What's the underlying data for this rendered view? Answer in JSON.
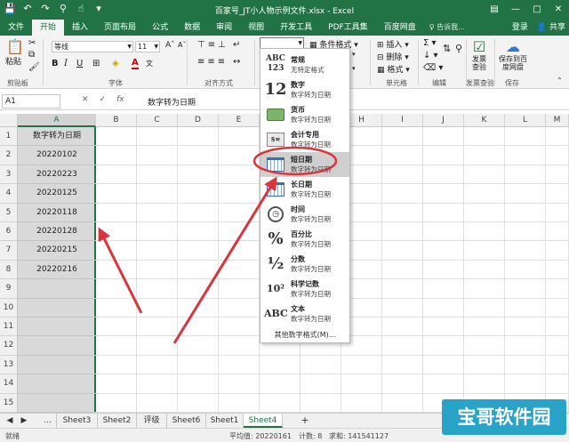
{
  "titlebar": {
    "title": "百家号_JT小人物示例文件.xlsx - Excel",
    "qat_icons": [
      "save-icon",
      "undo-icon",
      "redo-icon",
      "search-icon",
      "touch-icon",
      "customize-icon"
    ]
  },
  "tabs": {
    "items": [
      "文件",
      "开始",
      "插入",
      "页面布局",
      "公式",
      "数据",
      "审阅",
      "视图",
      "开发工具",
      "PDF工具集",
      "百度网盘"
    ],
    "active": "开始",
    "tell_me": "♀ 告诉我...",
    "login": "登录",
    "share": "共享"
  },
  "ribbon": {
    "paste_label": "粘贴",
    "clipboard_label": "剪贴板",
    "font_name": "等线",
    "font_size": "11",
    "font_group_label": "字体",
    "align_group_label": "对齐方式",
    "cond_format_label": "条件格式",
    "insert_label": "插入",
    "delete_label": "删除",
    "format_label": "格式",
    "cells_group_label": "单元格",
    "edit_group_label": "编辑",
    "invoice_check_label": "发票查验",
    "invoice_check_group": "发票查验",
    "save_baidu_label": "保存到百度网盘",
    "save_group": "保存",
    "bold": "B",
    "italic": "I",
    "underline": "U",
    "font_color": "A"
  },
  "formula_bar": {
    "name_box": "A1",
    "cancel": "✕",
    "confirm": "✓",
    "fx": "fx",
    "formula": "数字转为日期"
  },
  "grid": {
    "columns": [
      "A",
      "B",
      "C",
      "D",
      "E",
      "F",
      "G",
      "H",
      "I",
      "J",
      "K",
      "L",
      "M"
    ],
    "rows": [
      "1",
      "2",
      "3",
      "4",
      "5",
      "6",
      "7",
      "8",
      "9",
      "10",
      "11",
      "12",
      "13",
      "14",
      "15"
    ],
    "column_a": [
      "数字转为日期",
      "20220102",
      "20220223",
      "20220125",
      "20220118",
      "20220128",
      "20220215",
      "20220216"
    ]
  },
  "number_format_menu": {
    "items": [
      {
        "icon": "ABC\n123",
        "name": "常规",
        "desc": "无特定格式"
      },
      {
        "icon": "12",
        "name": "数字",
        "desc": "数字转为日期"
      },
      {
        "icon": "currency-icon",
        "name": "货币",
        "desc": "数字转为日期"
      },
      {
        "icon": "accounting-icon",
        "name": "会计专用",
        "desc": "数字转为日期"
      },
      {
        "icon": "short-date-icon",
        "name": "短日期",
        "desc": "数字转为日期"
      },
      {
        "icon": "long-date-icon",
        "name": "长日期",
        "desc": "数字转为日期"
      },
      {
        "icon": "clock-icon",
        "name": "时间",
        "desc": "数字转为日期"
      },
      {
        "icon": "%",
        "name": "百分比",
        "desc": "数字转为日期"
      },
      {
        "icon": "½",
        "name": "分数",
        "desc": "数字转为日期"
      },
      {
        "icon": "10²",
        "name": "科学记数",
        "desc": "数字转为日期"
      },
      {
        "icon": "ABC",
        "name": "文本",
        "desc": "数字转为日期"
      }
    ],
    "highlighted_index": 4,
    "more": "其他数字格式(M)..."
  },
  "sheets": {
    "items": [
      "Sheet3",
      "Sheet2",
      "评级",
      "Sheet6",
      "Sheet1",
      "Sheet4"
    ],
    "active": "Sheet4",
    "more": "...",
    "add": "+"
  },
  "statusbar": {
    "ready": "就绪",
    "average": "平均值: 20220161",
    "count": "计数: 8",
    "sum": "求和: 141541127"
  },
  "watermark": {
    "text": "宝哥软件园"
  },
  "colors": {
    "excel_green": "#217346",
    "annotation_red": "#d9353b",
    "watermark_bg": "#2aa3c9"
  }
}
